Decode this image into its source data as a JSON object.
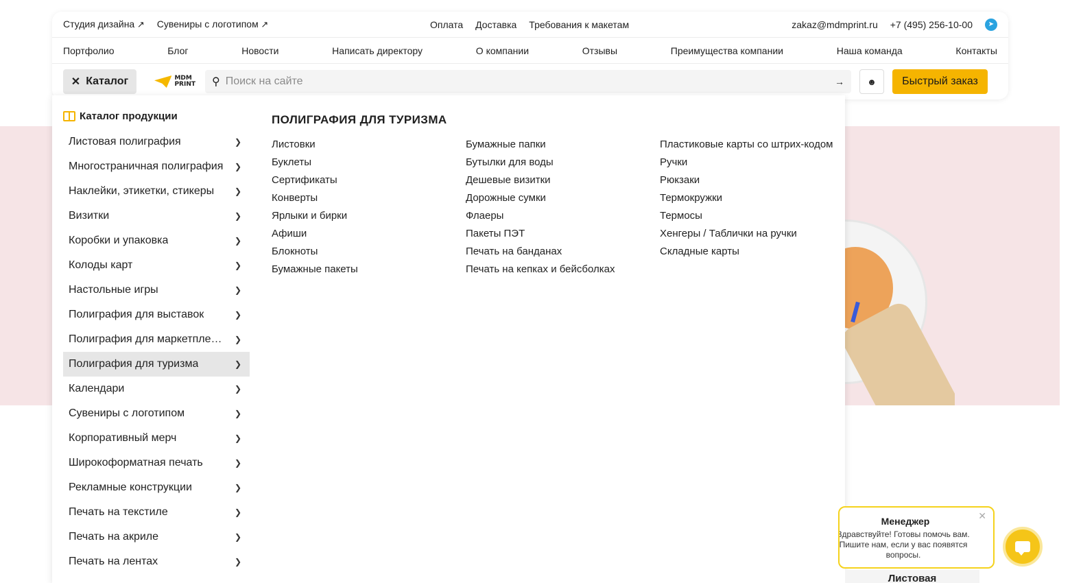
{
  "topbar": {
    "left_links": [
      "Студия дизайна",
      "Сувениры с логотипом"
    ],
    "center_links": [
      "Оплата",
      "Доставка",
      "Требования к макетам"
    ],
    "email": "zakaz@mdmprint.ru",
    "phone": "+7 (495) 256-10-00",
    "telegram_icon": "telegram-icon"
  },
  "nav": [
    "Портфолио",
    "Блог",
    "Новости",
    "Написать директору",
    "О компании",
    "Отзывы",
    "Преимущества компании",
    "Наша команда",
    "Контакты"
  ],
  "toolbar": {
    "catalog_label": "Каталог",
    "logo_line1": "MDM",
    "logo_line2": "PRINT",
    "search_placeholder": "Поиск на сайте",
    "quick_order_label": "Быстрый заказ"
  },
  "catalog": {
    "title": "Каталог продукции",
    "categories": [
      "Листовая полиграфия",
      "Многостраничная полиграфия",
      "Наклейки, этикетки, стикеры",
      "Визитки",
      "Коробки и упаковка",
      "Колоды карт",
      "Настольные игры",
      "Полиграфия для выставок",
      "Полиграфия для маркетплейсов",
      "Полиграфия для туризма",
      "Календари",
      "Сувениры с логотипом",
      "Корпоративный мерч",
      "Широкоформатная печать",
      "Рекламные конструкции",
      "Печать на текстиле",
      "Печать на акриле",
      "Печать на лентах"
    ],
    "active_category": "Полиграфия для туризма",
    "subcategory_title": "ПОЛИГРАФИЯ ДЛЯ ТУРИЗМА",
    "columns": [
      [
        "Листовки",
        "Буклеты",
        "Сертификаты",
        "Конверты",
        "Ярлыки и бирки",
        "Афиши",
        "Блокноты",
        "Бумажные пакеты"
      ],
      [
        "Бумажные папки",
        "Бутылки для воды",
        "Дешевые визитки",
        "Дорожные сумки",
        "Флаеры",
        "Пакеты ПЭТ",
        "Печать на банданах",
        "Печать на кепках и бейсболках"
      ],
      [
        "Пластиковые карты со штрих-кодом",
        "Ручки",
        "Рюкзаки",
        "Термокружки",
        "Термосы",
        "Хенгеры / Таблички на ручки",
        "Складные карты"
      ]
    ]
  },
  "chat": {
    "manager_label": "Менеджер",
    "message": "Здравствуйте! Готовы помочь вам. Пишите нам, если у вас появятся вопросы."
  },
  "bottom_card_label": "Листовая",
  "colors": {
    "accent": "#f5b400",
    "banner_bg": "#f6e4e6",
    "active_row": "#e6e6e6"
  }
}
